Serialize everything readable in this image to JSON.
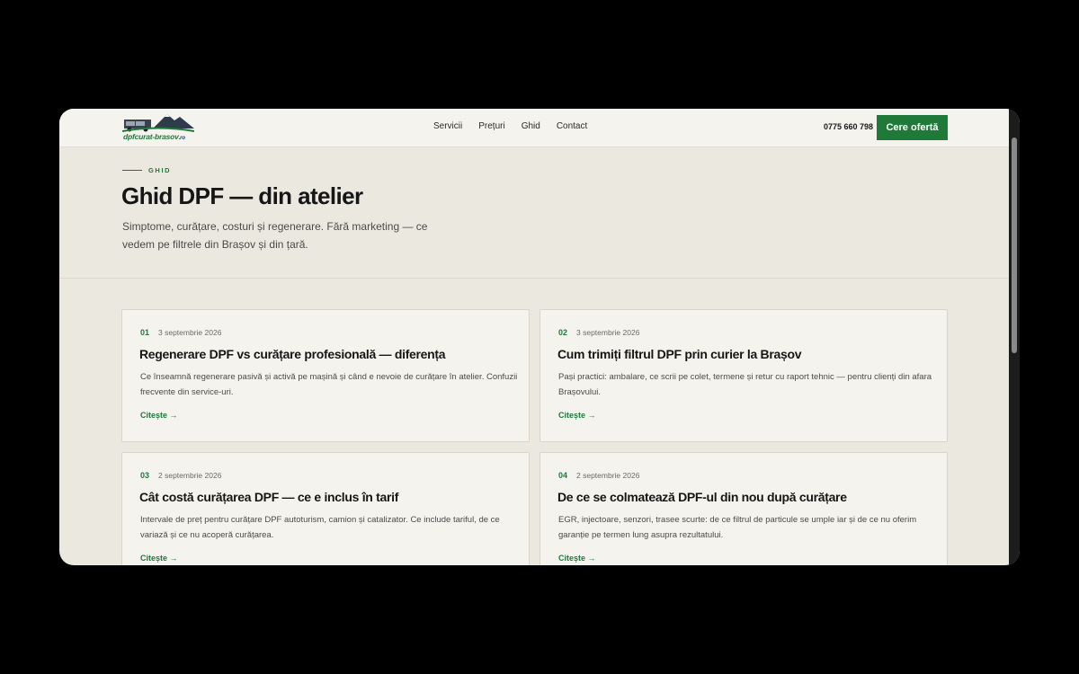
{
  "header": {
    "logo_text": "dpfcurat-brasov",
    "logo_tld": ".ro",
    "nav": [
      "Servicii",
      "Prețuri",
      "Ghid",
      "Contact"
    ],
    "phone": "0775 660 798",
    "cta_label": "Cere ofertă",
    "accent_color": "#1f7a3a"
  },
  "hero": {
    "eyebrow": "GHID",
    "title": "Ghid DPF — din atelier",
    "intro": "Simptome, curățare, costuri și regenerare. Fără marketing — ce vedem pe filtrele din Brașov și din țară."
  },
  "articles": [
    {
      "num": "01",
      "date": "3 septembrie 2026",
      "title": "Regenerare DPF vs curățare profesională — diferența",
      "desc": "Ce înseamnă regenerare pasivă și activă pe mașină și când e nevoie de curățare în atelier. Confuzii frecvente din service-uri.",
      "link": "Citește →"
    },
    {
      "num": "02",
      "date": "3 septembrie 2026",
      "title": "Cum trimiți filtrul DPF prin curier la Brașov",
      "desc": "Pași practici: ambalare, ce scrii pe colet, termene și retur cu raport tehnic — pentru clienți din afara Brașovului.",
      "link": "Citește →"
    },
    {
      "num": "03",
      "date": "2 septembrie 2026",
      "title": "Cât costă curățarea DPF — ce e inclus în tarif",
      "desc": "Intervale de preț pentru curățare DPF autoturism, camion și catalizator. Ce include tariful, de ce variază și ce nu acoperă curățarea.",
      "link": "Citește →"
    },
    {
      "num": "04",
      "date": "2 septembrie 2026",
      "title": "De ce se colmatează DPF-ul din nou după curățare",
      "desc": "EGR, injectoare, senzori, trasee scurte: de ce filtrul de particule se umple iar și de ce nu oferim garanție pe termen lung asupra rezultatului.",
      "link": "Citește →"
    }
  ]
}
